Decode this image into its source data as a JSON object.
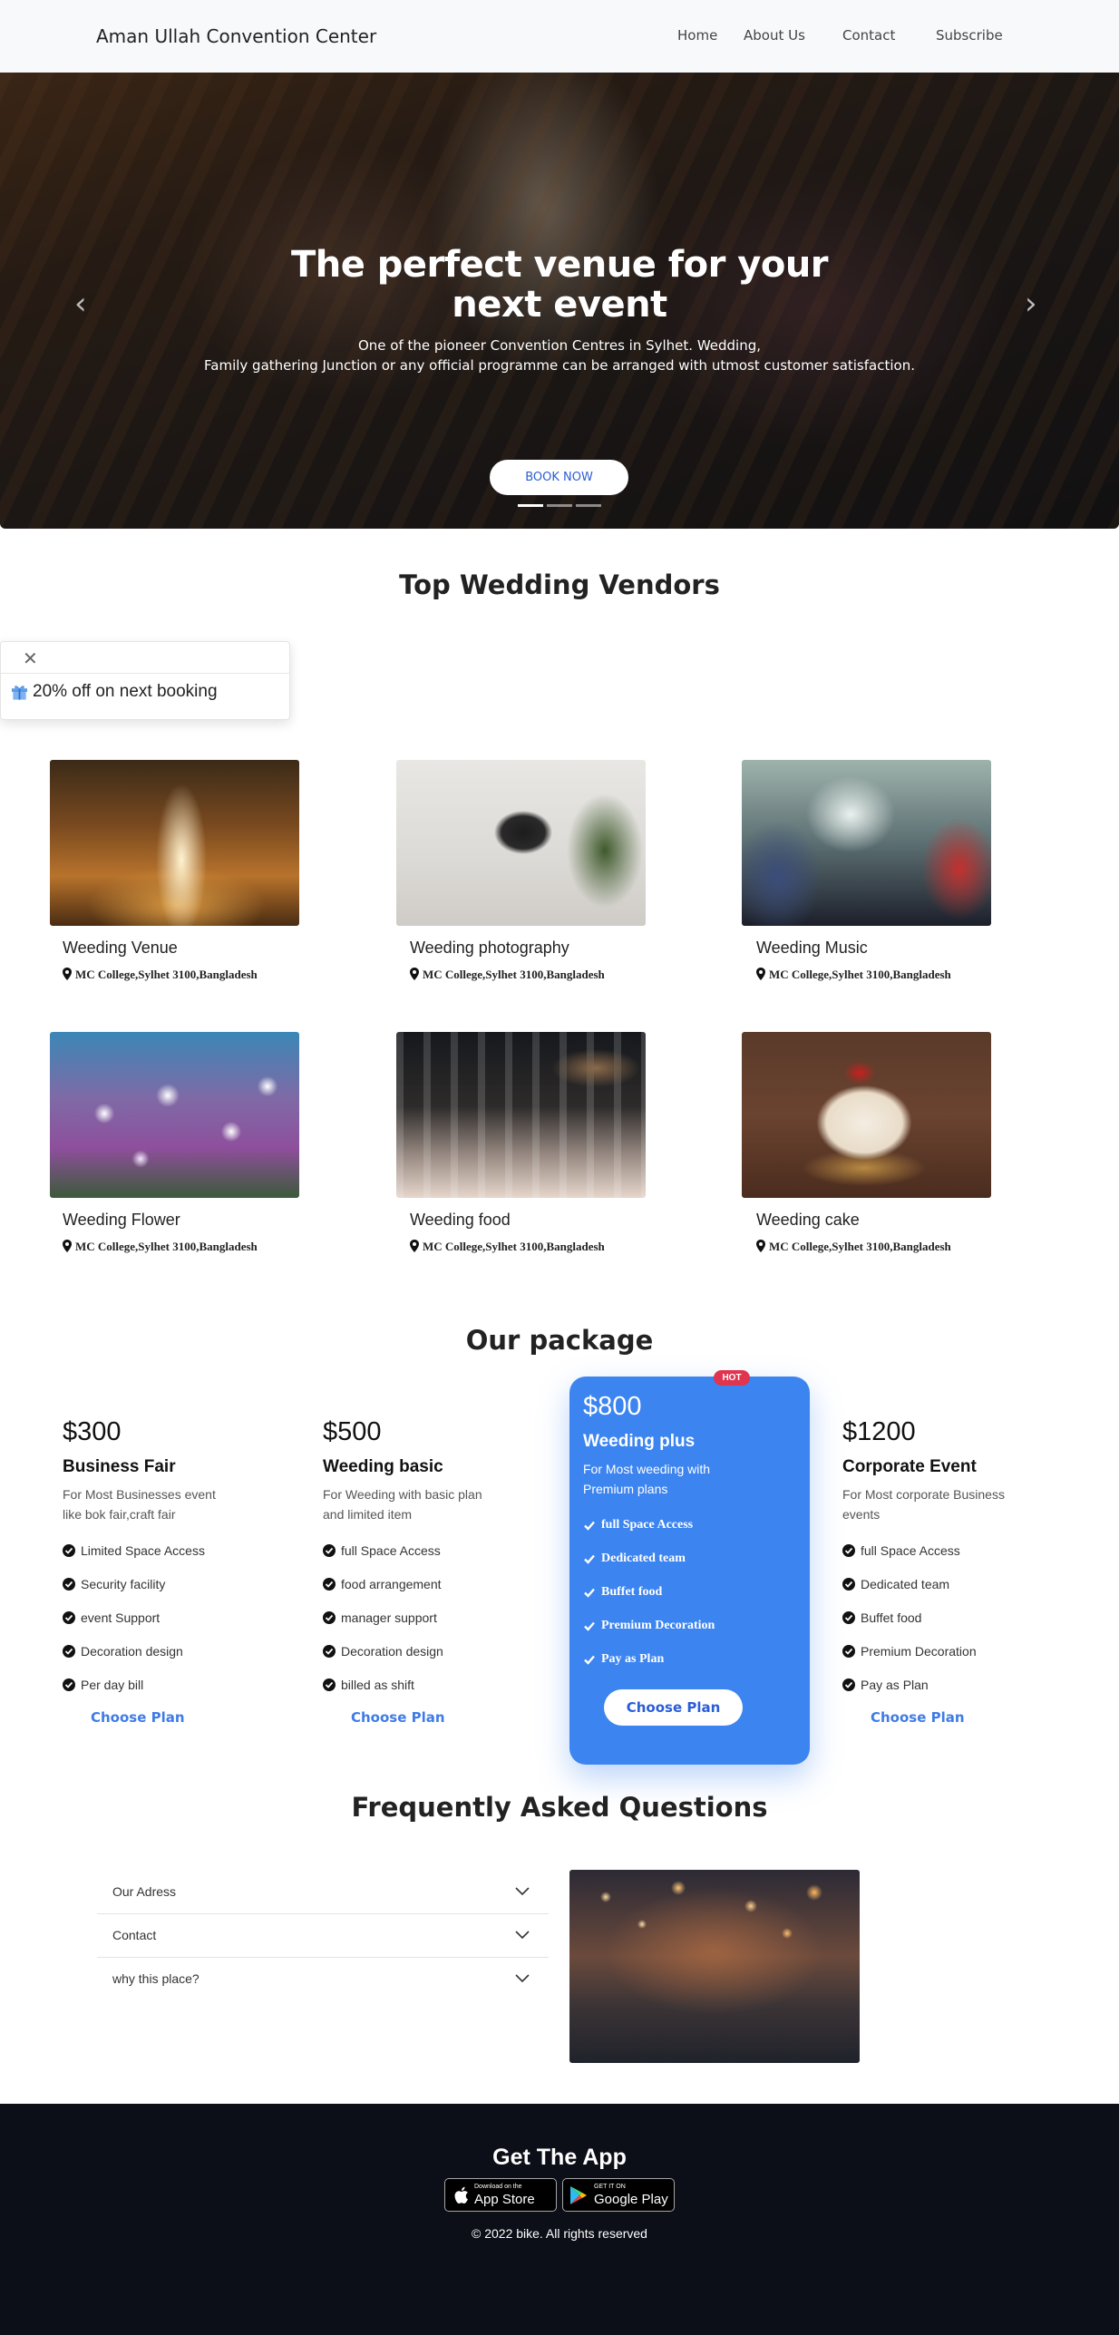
{
  "nav": {
    "brand": "Aman Ullah Convention Center",
    "links": [
      "Home",
      "About Us",
      "Contact",
      "Subscribe"
    ]
  },
  "hero": {
    "title_line1": "The perfect venue for your",
    "title_line2": "next event",
    "subtitle_line1": "One of the pioneer Convention Centres in Sylhet. Wedding,",
    "subtitle_line2": "Family gathering Junction or any official programme can be arranged with utmost customer satisfaction.",
    "cta": "BOOK NOW",
    "prev_icon": "chevron-left-icon",
    "next_icon": "chevron-right-icon",
    "slides": 3,
    "active_slide": 1
  },
  "vendors": {
    "title": "Top Wedding Vendors",
    "items": [
      {
        "name": "Weeding Venue",
        "location": "MC College,Sylhet 3100,Bangladesh"
      },
      {
        "name": "Weeding photography",
        "location": "MC College,Sylhet 3100,Bangladesh"
      },
      {
        "name": "Weeding Music",
        "location": "MC College,Sylhet 3100,Bangladesh"
      },
      {
        "name": "Weeding Flower",
        "location": "MC College,Sylhet 3100,Bangladesh"
      },
      {
        "name": "Weeding food",
        "location": "MC College,Sylhet 3100,Bangladesh"
      },
      {
        "name": "Weeding cake",
        "location": "MC College,Sylhet 3100,Bangladesh"
      }
    ]
  },
  "toast": {
    "text": "20% off on next booking",
    "icon": "gift-icon"
  },
  "packages": {
    "title": "Our package",
    "badge": "HOT",
    "cta": "Choose Plan",
    "items": [
      {
        "price": "$300",
        "name": "Business Fair",
        "desc": "For Most Businesses event like bok fair,craft fair",
        "features": [
          "Limited Space Access",
          "Security facility",
          "event Support",
          "Decoration design",
          "Per day bill"
        ]
      },
      {
        "price": "$500",
        "name": "Weeding basic",
        "desc": "For Weeding with basic plan and limited item",
        "features": [
          "full Space Access",
          "food arrangement",
          "manager support",
          "Decoration design",
          "billed as shift"
        ]
      },
      {
        "price": "$800",
        "name": "Weeding plus",
        "desc": "For Most weeding with Premium plans",
        "features": [
          "full Space Access",
          "Dedicated team",
          "Buffet food",
          "Premium Decoration",
          "Pay as Plan"
        ]
      },
      {
        "price": "$1200",
        "name": "Corporate Event",
        "desc": "For Most corporate Business events",
        "features": [
          "full Space Access",
          "Dedicated team",
          "Buffet food",
          "Premium Decoration",
          "Pay as Plan"
        ]
      }
    ]
  },
  "faq": {
    "title": "Frequently Asked Questions",
    "items": [
      "Our Adress",
      "Contact",
      "why this place?"
    ]
  },
  "footer": {
    "title": "Get The App",
    "appstore_small": "Download on the",
    "appstore_big": "App Store",
    "googleplay_small": "GET IT ON",
    "googleplay_big": "Google Play",
    "copyright": "© 2022 bike. All rights reserved"
  },
  "colors": {
    "accent": "#3c84ef",
    "link": "#3f7be6",
    "hot": "#e0344f",
    "footer_bg": "#0c0e18"
  }
}
